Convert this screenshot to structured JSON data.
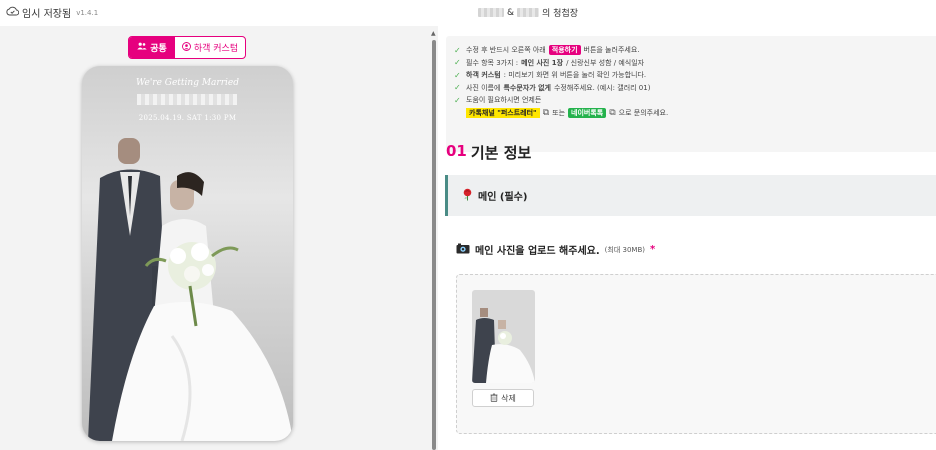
{
  "header": {
    "save_status": "임시 저장됨",
    "version": "v1.4.1",
    "title_connector": "&",
    "title_suffix": "의 청첩장"
  },
  "preview": {
    "tabs": [
      {
        "label": "공통",
        "icon": "group-icon",
        "active": true
      },
      {
        "label": "하객 커스텀",
        "icon": "user-circle-icon",
        "active": false
      }
    ],
    "invite": {
      "heading": "We're Getting Married",
      "date": "2025.04.19. SAT 1:30 PM"
    }
  },
  "notice": {
    "line1_before": "수정 후 반드시 오른쪽 아래",
    "line1_chip": "적용하기",
    "line1_after": "버튼을 눌러주세요.",
    "line2_before": "필수 항목 3가지 :",
    "line2_bold": "메인 사진 1장",
    "line2_after": "/ 신랑신부 성함 / 예식일자",
    "line3_bold": "하객 커스텀",
    "line3_after": ": 미리보기 화면 위 버튼을 눌러 확인 가능합니다.",
    "line4_before": "사진 이름에",
    "line4_bold": "특수문자가 없게",
    "line4_after": "수정해주세요. (예시: 갤러리 01)",
    "line5": "도움이 필요하시면 언제든",
    "kakao_chip": "카톡채널 \"퍼스트레터\"",
    "or_text": "또는",
    "naver_chip": "네이버톡톡",
    "contact_after": "으로 문의주세요."
  },
  "section": {
    "number": "01",
    "title": "기본 정보",
    "subsection_title": "메인 (필수)",
    "upload_label": "메인 사진을 업로드 해주세요.",
    "upload_hint": "(최대 30MB)",
    "required_mark": "*",
    "delete_label": "삭제"
  },
  "colors": {
    "accent": "#e6007e",
    "check": "#4caf50",
    "kakao": "#ffe600",
    "naver": "#24b24c",
    "subsection_border": "#4a8c86"
  }
}
